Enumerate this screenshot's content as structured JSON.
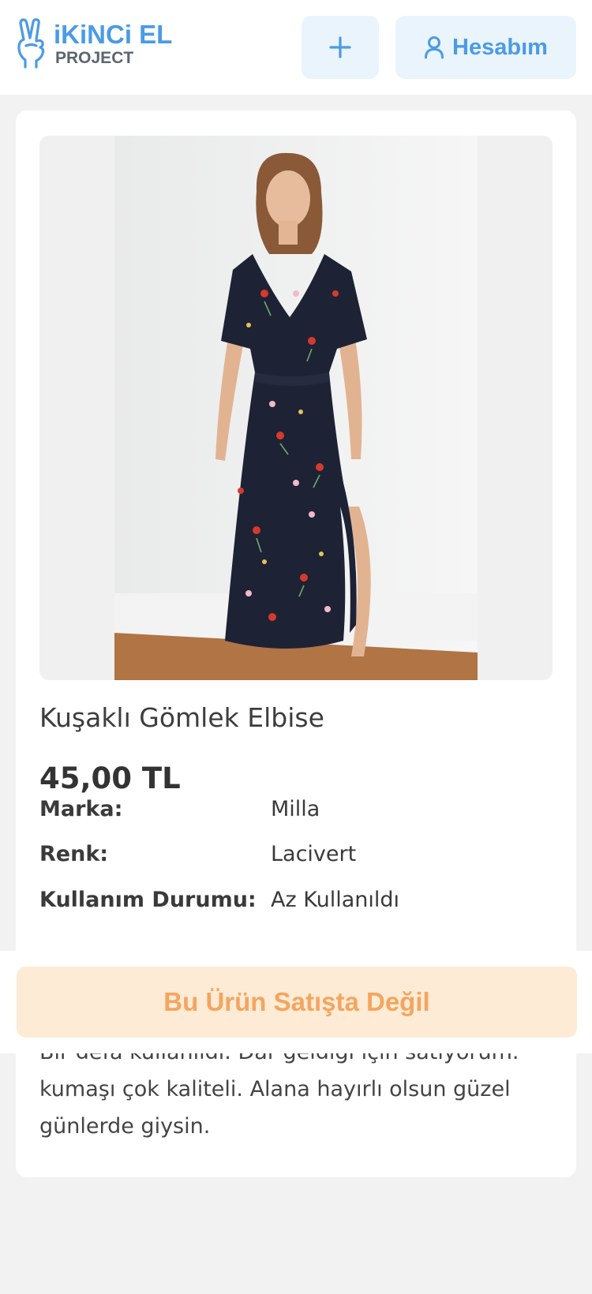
{
  "header": {
    "logo_top": "iKiNCi EL",
    "logo_bottom": "PROJECT",
    "add_label": "+",
    "account_label": "Hesabım"
  },
  "product": {
    "title": "Kuşaklı Gömlek Elbise",
    "price": "45,00 TL",
    "specs": [
      {
        "label": "Marka:",
        "value": "Milla"
      },
      {
        "label": "Renk:",
        "value": "Lacivert"
      },
      {
        "label": "Kullanım Durumu:",
        "value": "Az Kullanıldı"
      }
    ],
    "description_lines": [
      "Bir defa kullanıldı. Dar geldiği için satıyorum.",
      "kumaşı çok kaliteli. Alana hayırlı olsun güzel",
      "günlerde giysin."
    ]
  },
  "status_banner": "Bu Ürün Satışta Değil",
  "colors": {
    "brand": "#4b9be5",
    "button_bg": "#eaf4fd",
    "banner_bg": "#feebd6",
    "banner_text": "#f4a55e",
    "page_bg": "#f2f2f2"
  }
}
